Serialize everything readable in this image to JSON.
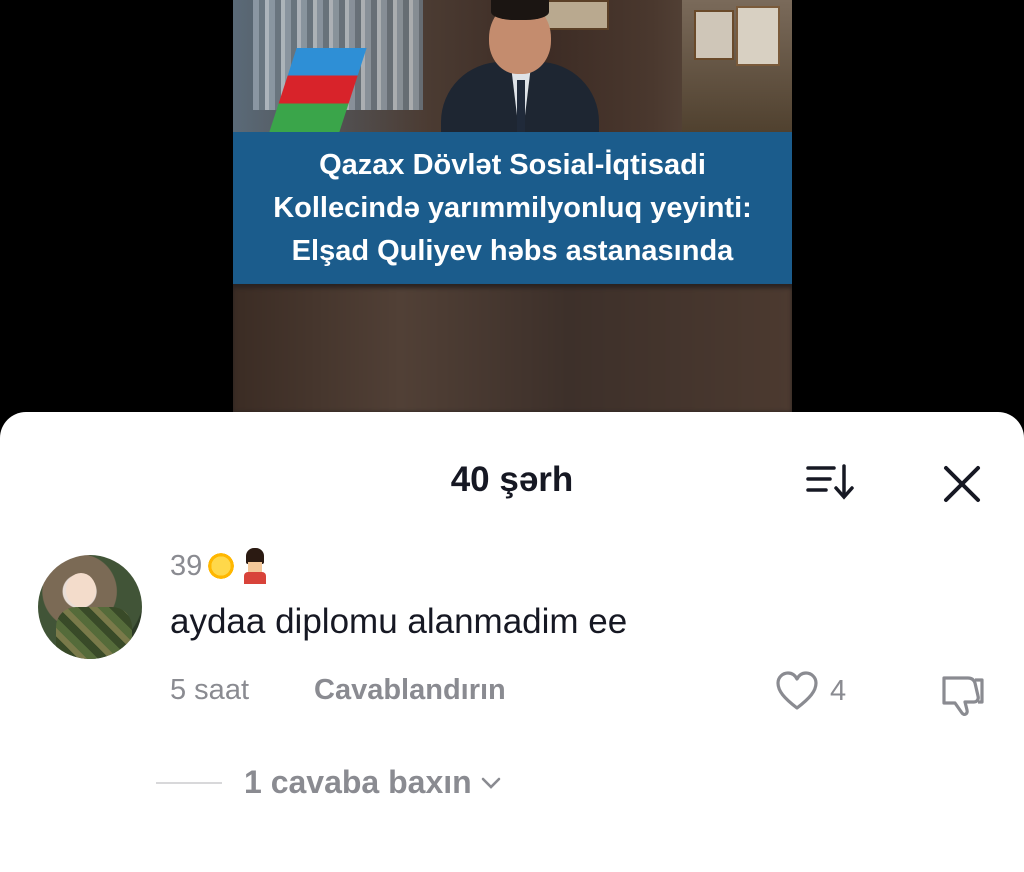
{
  "video": {
    "headline_lines": [
      "Qazax Dövlət Sosial-İqtisadi",
      "Kollecində yarımmilyonluq yeyinti:",
      "Elşad Quliyev həbs astanasında"
    ],
    "banner_color": "#1b5c8c"
  },
  "sheet": {
    "title": "40 şərh",
    "sort_icon": "sort-icon",
    "close_icon": "close-icon"
  },
  "comment": {
    "username": "39",
    "username_emojis": [
      "sun-emoji",
      "guard-emoji"
    ],
    "text": "aydaa diplomu alanmadim ee",
    "time": "5 saat",
    "reply_label": "Cavablandırın",
    "likes": "4",
    "view_replies": "1 cavaba baxın"
  }
}
